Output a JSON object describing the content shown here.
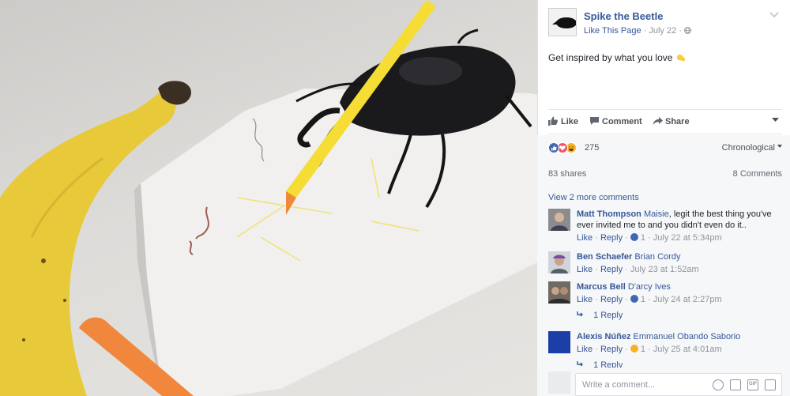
{
  "post": {
    "page_name": "Spike the Beetle",
    "like_page": "Like This Page",
    "date": "July 22",
    "separator": "·",
    "privacy_icon": "globe-icon",
    "text": "Get inspired by what you love",
    "text_emoji": "raised-fist-emoji"
  },
  "actions": {
    "like": "Like",
    "comment": "Comment",
    "share": "Share"
  },
  "reactions": {
    "icons": [
      "like-reaction",
      "love-reaction",
      "haha-reaction"
    ],
    "count": "275",
    "sort": "Chronological"
  },
  "stats": {
    "shares": "83 shares",
    "comments": "8 Comments"
  },
  "comments_section": {
    "view_more": "View 2 more comments",
    "items": [
      {
        "author": "Matt Thompson",
        "tag": "Maisie",
        "text": ", legit the best thing you've ever invited me to and you didn't even do it..",
        "like": "Like",
        "reply": "Reply",
        "reaction_icon": "like-reaction",
        "reaction_count": "1",
        "time": "July 22 at 5:34pm"
      },
      {
        "author": "Ben Schaefer",
        "tag": "Brian Cordy",
        "text": "",
        "like": "Like",
        "reply": "Reply",
        "time": "July 23 at 1:52am"
      },
      {
        "author": "Marcus Bell",
        "tag": "D'arcy Ives",
        "text": "",
        "like": "Like",
        "reply": "Reply",
        "reaction_icon": "like-reaction",
        "reaction_count": "1",
        "time": "July 24 at 2:27pm",
        "replies": "1 Reply"
      },
      {
        "author": "Alexis Núñez",
        "tag": "Emmanuel Obando Saborio",
        "text": "",
        "like": "Like",
        "reply": "Reply",
        "reaction_icon": "wow-reaction",
        "reaction_count": "1",
        "time": "July 25 at 4:01am",
        "replies": "1 Reply"
      }
    ]
  },
  "composer": {
    "placeholder": "Write a comment...",
    "icons": [
      "emoji-icon",
      "camera-icon",
      "gif-icon",
      "sticker-icon"
    ],
    "gif_label": "GIF"
  },
  "colors": {
    "link": "#365899",
    "meta": "#90949c",
    "like_blue": "#4267b2",
    "love_red": "#f25268",
    "haha_yellow": "#f7b125"
  }
}
